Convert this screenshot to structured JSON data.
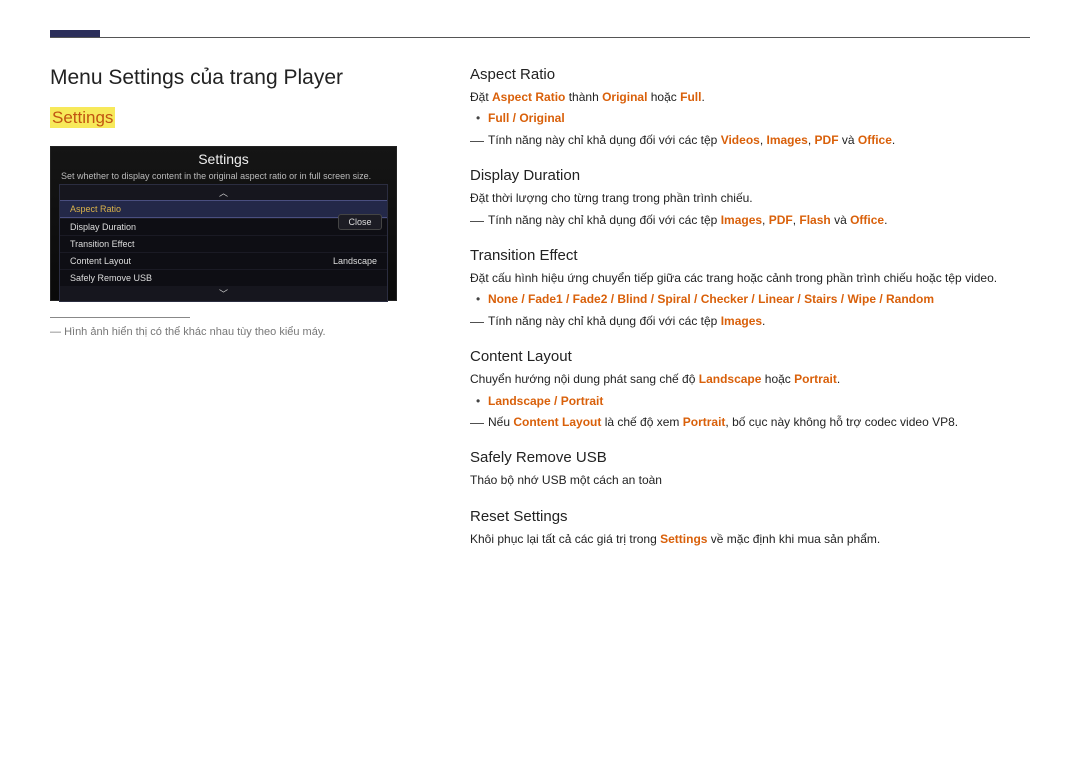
{
  "header": {
    "title": "Menu Settings của trang Player",
    "section": "Settings"
  },
  "uibox": {
    "title": "Settings",
    "desc": "Set whether to display content in the original aspect ratio or in full screen size.",
    "close": "Close",
    "items": {
      "i0": {
        "label": "Aspect Ratio",
        "value": ""
      },
      "i1": {
        "label": "Display Duration",
        "value": ""
      },
      "i2": {
        "label": "Transition Effect",
        "value": ""
      },
      "i3": {
        "label": "Content Layout",
        "value": "Landscape"
      },
      "i4": {
        "label": "Safely Remove USB",
        "value": ""
      }
    }
  },
  "caption": "Hình ảnh hiển thị có thể khác nhau tùy theo kiểu máy.",
  "sections": {
    "aspect": {
      "title": "Aspect Ratio",
      "p_pre": "Đặt ",
      "p_hl1": "Aspect Ratio",
      "p_mid": " thành ",
      "p_hl2": "Original",
      "p_mid2": " hoặc ",
      "p_hl3": "Full",
      "p_end": ".",
      "opts": "Full / Original",
      "note_pre": "Tính năng này chỉ khả dụng đối với các tệp ",
      "note_h1": "Videos",
      "note_s1": ", ",
      "note_h2": "Images",
      "note_s2": ", ",
      "note_h3": "PDF",
      "note_s3": " và ",
      "note_h4": "Office",
      "note_end": "."
    },
    "duration": {
      "title": "Display Duration",
      "p": "Đặt thời lượng cho từng trang trong phần trình chiếu.",
      "note_pre": "Tính năng này chỉ khả dụng đối với các tệp ",
      "note_h1": "Images",
      "note_s1": ", ",
      "note_h2": "PDF",
      "note_s2": ", ",
      "note_h3": "Flash",
      "note_s3": " và ",
      "note_h4": "Office",
      "note_end": "."
    },
    "trans": {
      "title": "Transition Effect",
      "p": "Đặt cấu hình hiệu ứng chuyển tiếp giữa các trang hoặc cảnh trong phần trình chiếu hoặc tệp video.",
      "opts": "None / Fade1 / Fade2 / Blind / Spiral / Checker / Linear / Stairs / Wipe / Random",
      "note_pre": "Tính năng này chỉ khả dụng đối với các tệp ",
      "note_h1": "Images",
      "note_end": "."
    },
    "layout": {
      "title": "Content Layout",
      "p_pre": "Chuyển hướng nội dung phát sang chế độ ",
      "p_h1": "Landscape",
      "p_mid": " hoặc ",
      "p_h2": "Portrait",
      "p_end": ".",
      "opts": "Landscape / Portrait",
      "note_pre": "Nếu ",
      "note_h1": "Content Layout",
      "note_mid": " là chế độ xem ",
      "note_h2": "Portrait",
      "note_end": ", bố cục này không hỗ trợ codec video VP8."
    },
    "usb": {
      "title": "Safely Remove USB",
      "p": "Tháo bộ nhớ USB một cách an toàn"
    },
    "reset": {
      "title": "Reset Settings",
      "p_pre": "Khôi phục lại tất cả các giá trị trong ",
      "p_h1": "Settings",
      "p_end": " về mặc định khi mua sản phẩm."
    }
  }
}
